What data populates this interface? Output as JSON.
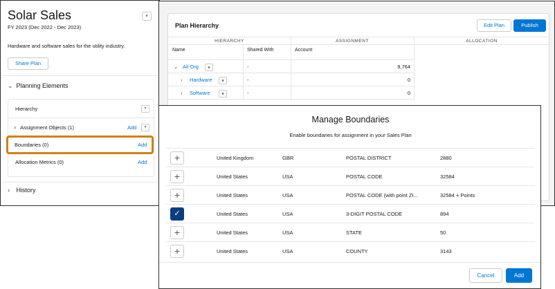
{
  "plan": {
    "title": "Solar Sales",
    "fiscal_year": "FY 2023 (Dec 2022 - Dec 2023)",
    "description": "Hardware and software sales for the utility industry.",
    "share_label": "Share Plan"
  },
  "sidebar": {
    "planning_elements_label": "Planning Elements",
    "hierarchy_label": "Hierarchy",
    "assignment_objects_label": "Assignment Objects (1)",
    "boundaries_label": "Boundaries (0)",
    "allocation_metrics_label": "Allocation Metrics (0)",
    "add_label": "Add",
    "history_label": "History"
  },
  "hierarchy": {
    "title": "Plan Hierarchy",
    "edit_label": "Edit Plan",
    "publish_label": "Publish",
    "group_headers": [
      "HIERARCHY",
      "ASSIGNMENT",
      "ALLOCATION"
    ],
    "columns": [
      "Name",
      "Shared With",
      "Account"
    ],
    "rows": [
      {
        "name": "All Org",
        "shared": "-",
        "account": "9,764"
      },
      {
        "name": "Hardware",
        "shared": "-",
        "account": "0"
      },
      {
        "name": "Software",
        "shared": "-",
        "account": "0"
      }
    ]
  },
  "modal": {
    "title": "Manage Boundaries",
    "subtitle": "Enable boundaries for assignment in your Sales Plan",
    "rows": [
      {
        "country": "United Kingdom",
        "code": "GBR",
        "type": "POSTAL DISTRICT",
        "count": "2880",
        "checked": false
      },
      {
        "country": "United States",
        "code": "USA",
        "type": "POSTAL CODE",
        "count": "32584",
        "checked": false
      },
      {
        "country": "United States",
        "code": "USA",
        "type": "POSTAL CODE (with point ZI...",
        "count": "32584 + Points",
        "checked": false
      },
      {
        "country": "United States",
        "code": "USA",
        "type": "3-DIGIT POSTAL CODE",
        "count": "894",
        "checked": true
      },
      {
        "country": "United States",
        "code": "USA",
        "type": "STATE",
        "count": "50",
        "checked": false
      },
      {
        "country": "United States",
        "code": "USA",
        "type": "COUNTY",
        "count": "3143",
        "checked": false
      }
    ],
    "cancel_label": "Cancel",
    "add_label": "Add"
  },
  "colors": {
    "brand": "#0176d3",
    "highlight": "#d37f17",
    "checked": "#0b3e80"
  },
  "icons": {
    "plus": "+",
    "check": "✓",
    "chevron_right": "›",
    "chevron_down": "⌄",
    "dropdown": "▾"
  }
}
